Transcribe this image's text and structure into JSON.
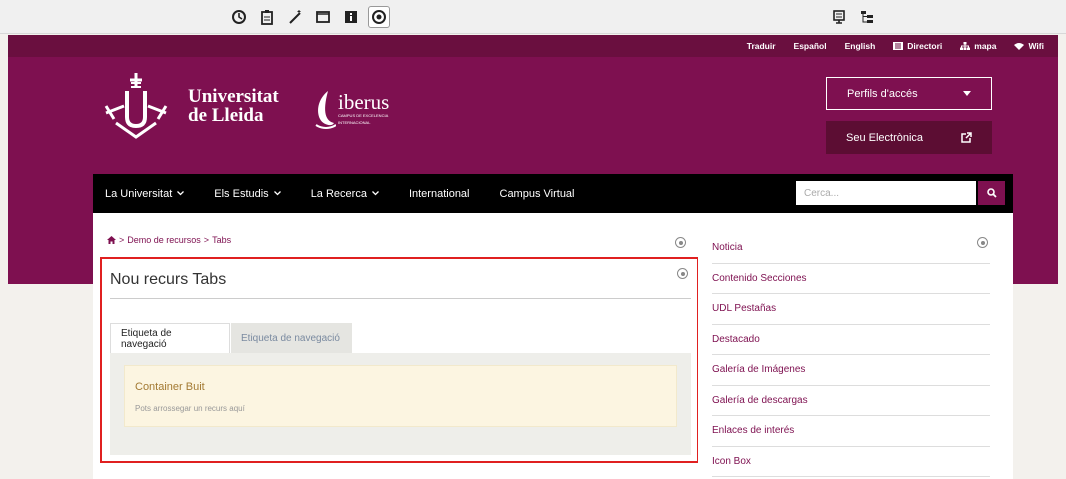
{
  "toolbar": {
    "left_icons": [
      "history-icon",
      "clipboard-icon",
      "magic-wand-icon",
      "window-icon",
      "info-icon",
      "target-icon"
    ],
    "right_icons": [
      "list-icon",
      "tree-icon"
    ]
  },
  "utility_links": [
    {
      "label": "Traduir"
    },
    {
      "label": "Español"
    },
    {
      "label": "English"
    },
    {
      "label": "Directori",
      "icon": "list-icon"
    },
    {
      "label": "mapa",
      "icon": "sitemap-icon"
    },
    {
      "label": "Wifi",
      "icon": "wifi-icon"
    }
  ],
  "header": {
    "university_line1": "Universitat",
    "university_line2": "de Lleida",
    "iberus_name": "iberus",
    "iberus_sub1": "CAMPUS DE EXCELENCIA",
    "iberus_sub2": "INTERNACIONAL",
    "perfils_label": "Perfils d'accés",
    "seu_label": "Seu Electrònica"
  },
  "nav": {
    "items": [
      {
        "label": "La Universitat",
        "dropdown": true
      },
      {
        "label": "Els Estudis",
        "dropdown": true
      },
      {
        "label": "La Recerca",
        "dropdown": true
      },
      {
        "label": "International",
        "dropdown": false
      },
      {
        "label": "Campus Virtual",
        "dropdown": false
      }
    ],
    "search_placeholder": "Cerca..."
  },
  "breadcrumb": {
    "separator": ">",
    "items": [
      "Demo de recursos",
      "Tabs"
    ]
  },
  "resource": {
    "title": "Nou recurs Tabs",
    "tabs": [
      "Etiqueta de navegació",
      "Etiqueta de navegació"
    ],
    "container_title": "Container Buit",
    "container_text": "Pots arrossegar un recurs aquí"
  },
  "sidebar": {
    "items": [
      "Noticia",
      "Contenido Secciones",
      "UDL Pestañas",
      "Destacado",
      "Galería de Imágenes",
      "Galería de descargas",
      "Enlaces de interés",
      "Icon Box"
    ]
  },
  "colors": {
    "brand": "#7e1050",
    "brand_dark": "#6a0f3f",
    "highlight": "#e02020",
    "container_bg": "#fcf5e1"
  }
}
